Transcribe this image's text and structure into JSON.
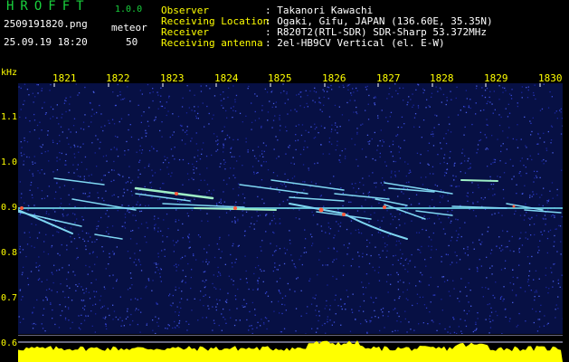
{
  "header": {
    "app_name": "HROFFT",
    "app_version": "1.0.0",
    "file_name": "2509191820.png",
    "datetime": "25.09.19 18:20",
    "detector_label": "meteor",
    "meteor_count": "50",
    "fields": [
      {
        "label": "Observer",
        "value": ": Takanori Kawachi"
      },
      {
        "label": "Receiving Location",
        "value": ": Ogaki, Gifu, JAPAN (136.60E, 35.35N)"
      },
      {
        "label": "Receiver",
        "value": ": R820T2(RTL-SDR) SDR-Sharp 53.372MHz"
      },
      {
        "label": "Receiving antenna",
        "value": ": 2el-HB9CV Vertical (el. E-W)"
      }
    ]
  },
  "spectrogram": {
    "y_unit": "kHz",
    "x_ticks": [
      "1821",
      "1822",
      "1823",
      "1824",
      "1825",
      "1826",
      "1827",
      "1828",
      "1829",
      "1830"
    ],
    "y_ticks": [
      "1.1",
      "1.0",
      "0.9",
      "0.8",
      "0.7",
      "0.6"
    ],
    "colors": {
      "background": "#071044",
      "noise": "#3a4bd6",
      "echo": "#7fd7f2",
      "center_line": "#8cffb2",
      "activity": "#ffff00",
      "text_yellow": "#ffff00",
      "app_green": "#19d13d"
    }
  }
}
